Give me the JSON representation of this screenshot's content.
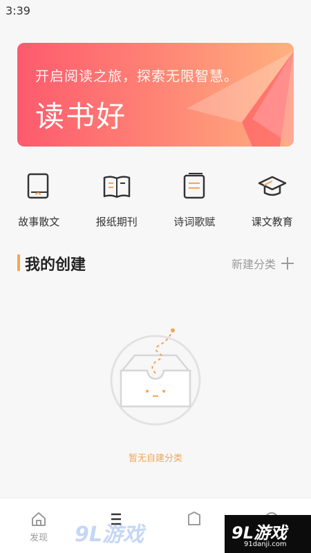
{
  "status": {
    "time": "3:39"
  },
  "banner": {
    "subtitle": "开启阅读之旅，探索无限智慧。",
    "title": "读书好"
  },
  "categories": [
    {
      "label": "故事散文",
      "icon": "story-book-icon"
    },
    {
      "label": "报纸期刊",
      "icon": "open-book-icon"
    },
    {
      "label": "诗词歌赋",
      "icon": "poetry-book-icon"
    },
    {
      "label": "课文教育",
      "icon": "graduation-cap-icon"
    }
  ],
  "section": {
    "title": "我的创建",
    "new_category_label": "新建分类"
  },
  "empty_state": {
    "text": "暂无自建分类"
  },
  "bottom_nav": [
    {
      "label": "发现",
      "icon": "home-icon"
    },
    {
      "label": "",
      "icon": "list-icon"
    },
    {
      "label": "",
      "icon": "bookshelf-icon"
    },
    {
      "label": "",
      "icon": "profile-icon"
    }
  ],
  "watermark": {
    "text": "9L游戏",
    "sub": "91danji.com"
  },
  "colors": {
    "accent": "#f6a453",
    "banner_start": "#fd5a6d",
    "banner_end": "#ffb07f"
  }
}
